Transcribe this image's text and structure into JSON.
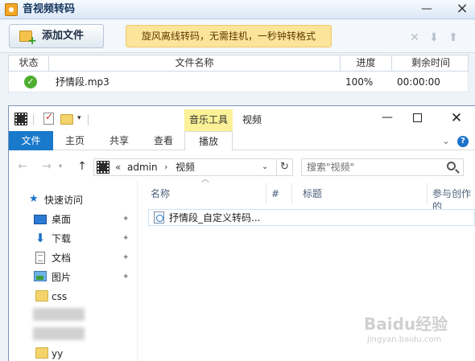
{
  "converter": {
    "title": "音视频转码",
    "add_file": "添加文件",
    "banner": "旋风离线转码，无需挂机，一秒钟转格式",
    "columns": {
      "status": "状态",
      "filename": "文件名称",
      "progress": "进度",
      "remaining": "剩余时间"
    },
    "rows": [
      {
        "status": "done",
        "filename": "抒情段.mp3",
        "progress": "100%",
        "remaining": "00:00:00"
      }
    ]
  },
  "explorer": {
    "contextual_tab_group": "音乐工具",
    "title": "视频",
    "ribbon_tabs": [
      "文件",
      "主页",
      "共享",
      "查看",
      "播放"
    ],
    "address": {
      "breadcrumbs": [
        "admin",
        "视频"
      ]
    },
    "search": {
      "placeholder": "搜索\"视频\""
    },
    "navigation": [
      {
        "label": "快速访问",
        "icon": "star-icon"
      },
      {
        "label": "桌面",
        "icon": "desktop-icon",
        "pinned": true
      },
      {
        "label": "下载",
        "icon": "download-icon",
        "pinned": true
      },
      {
        "label": "文档",
        "icon": "document-icon",
        "pinned": true
      },
      {
        "label": "图片",
        "icon": "picture-icon",
        "pinned": true
      },
      {
        "label": "css",
        "icon": "folder-icon"
      },
      {
        "label": "yy",
        "icon": "folder-icon"
      }
    ],
    "columns": {
      "name": "名称",
      "number": "#",
      "title": "标题",
      "contributing_artist": "参与创作的"
    },
    "files": [
      {
        "name": "抒情段_自定义转码..."
      }
    ]
  },
  "watermark": {
    "brand": "Baidu经验",
    "url": "jingyan.baidu.com"
  },
  "colors": {
    "ribbon_file_tab": "#1979ca",
    "contextual_tab": "#fbf196",
    "banner": "#fde49b",
    "success": "#4eae2f"
  }
}
